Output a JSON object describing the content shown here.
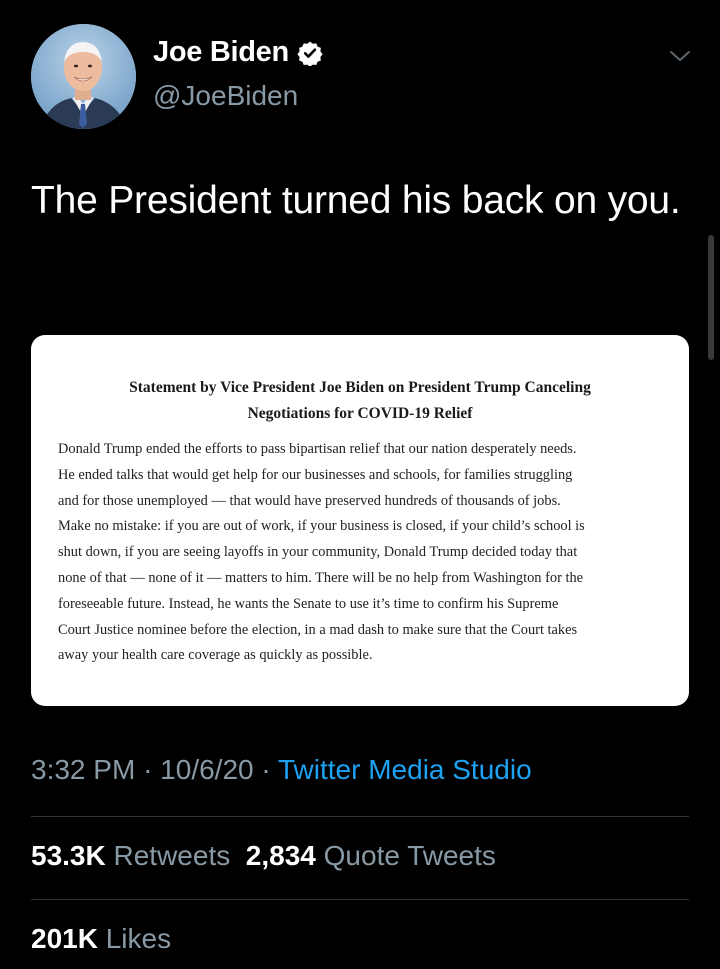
{
  "author": {
    "display_name": "Joe Biden",
    "handle": "@JoeBiden",
    "verified": true,
    "avatar_icon": "profile-photo",
    "verified_icon": "verified-badge-icon",
    "menu_icon": "chevron-down-icon"
  },
  "tweet": {
    "text": "The President turned his back on you."
  },
  "media": {
    "title_line1": "Statement by Vice President Joe Biden on President Trump Canceling",
    "title_line2": "Negotiations for COVID-19 Relief",
    "body_lines": [
      "Donald Trump ended the efforts to pass bipartisan relief that our nation desperately needs.",
      "He ended talks that would get help for our businesses and schools, for families struggling",
      "and for those unemployed — that would have preserved hundreds of thousands of jobs.",
      "Make no mistake: if you are out of work, if your business is closed, if your child’s school is",
      "shut down, if you are seeing layoffs in your community, Donald Trump decided today that",
      "none of that — none of it — matters to him. There will be no help from Washington for the",
      "foreseeable future. Instead, he wants the Senate to use it’s time to confirm his Supreme",
      "Court Justice nominee before the election, in a mad dash to make sure that the Court takes",
      "away your health care coverage as quickly as possible."
    ]
  },
  "meta": {
    "time": "3:32 PM",
    "date": "10/6/20",
    "separator": "·",
    "source": "Twitter Media Studio"
  },
  "stats": {
    "retweets_count": "53.3K",
    "retweets_label": "Retweets",
    "quotes_count": "2,834",
    "quotes_label": "Quote Tweets",
    "likes_count": "201K",
    "likes_label": "Likes"
  },
  "colors": {
    "background": "#000000",
    "text": "#ffffff",
    "secondary_text": "#8899a6",
    "link": "#1da1f2",
    "divider": "#2f3336"
  }
}
